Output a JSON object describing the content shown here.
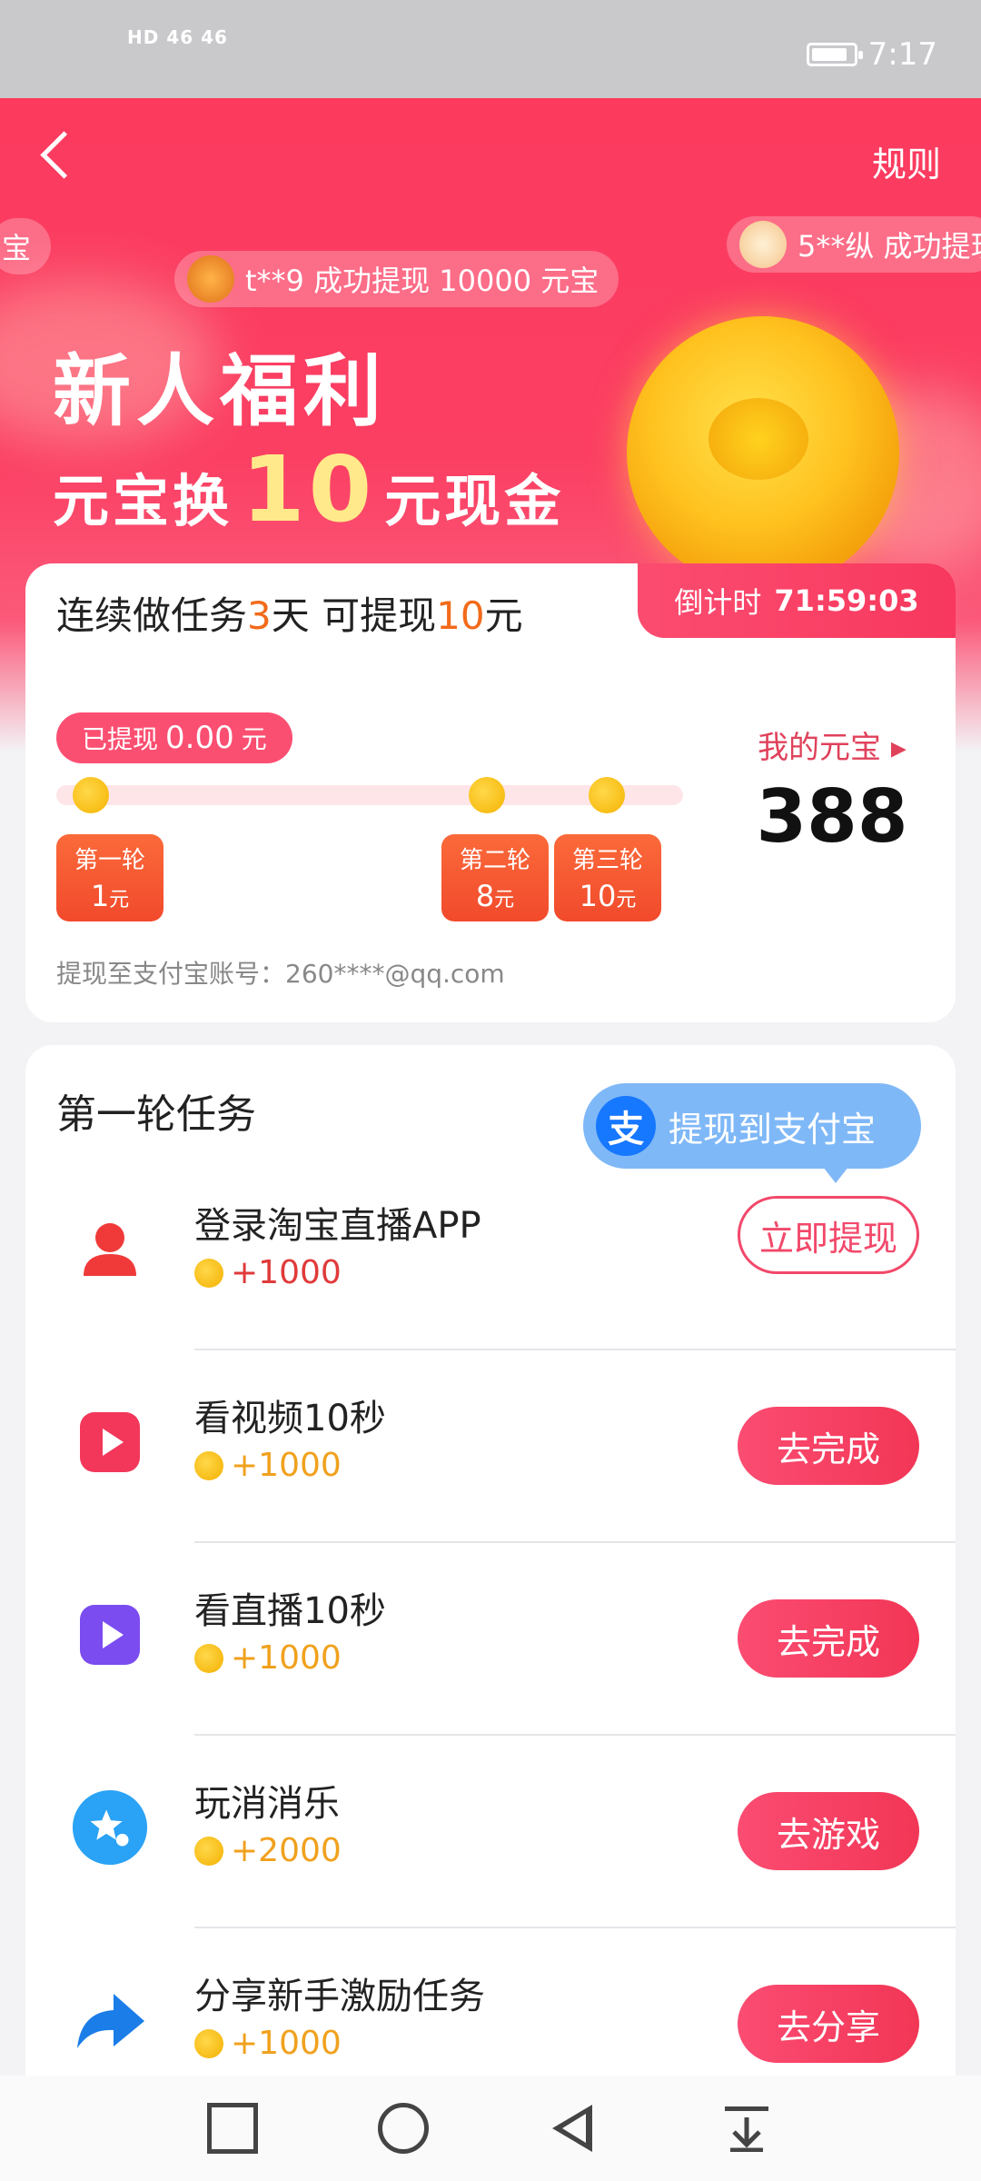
{
  "status_bar": {
    "left": "HD 46 46",
    "time": "7:17"
  },
  "header": {
    "back_label": "",
    "rules_label": "规则"
  },
  "tickers": [
    {
      "text": "宝"
    },
    {
      "text": "t**9 成功提现 10000 元宝"
    },
    {
      "text": "5**纵 成功提现"
    }
  ],
  "hero": {
    "line1": "新人福利",
    "line2_prefix": "元宝换",
    "line2_num": "10",
    "line2_suffix": "元现金"
  },
  "progress_card": {
    "title_a": "连续做任务",
    "title_days": "3",
    "title_b": "天 可提现",
    "title_amt": "10",
    "title_c": "元",
    "countdown_label": "倒计时",
    "countdown_value": "71:59:03",
    "withdrawn_label": "已提现",
    "withdrawn_value": "0.00",
    "withdrawn_unit": "元",
    "rounds": [
      {
        "label": "第一轮",
        "amount": "1",
        "unit": "元"
      },
      {
        "label": "第二轮",
        "amount": "8",
        "unit": "元"
      },
      {
        "label": "第三轮",
        "amount": "10",
        "unit": "元"
      }
    ],
    "my_coins_label": "我的元宝",
    "my_coins_value": "388",
    "alipay_account": "提现至支付宝账号：260****@qq.com"
  },
  "tasks_card": {
    "title": "第一轮任务",
    "tooltip_logo": "支",
    "tooltip_text": "提现到支付宝",
    "tasks": [
      {
        "name": "登录淘宝直播APP",
        "reward": "+1000",
        "button": "立即提现",
        "icon": "user-icon",
        "color": "#f03a3a"
      },
      {
        "name": "看视频10秒",
        "reward": "+1000",
        "button": "去完成",
        "icon": "video-play-icon",
        "color": "#f2375a"
      },
      {
        "name": "看直播10秒",
        "reward": "+1000",
        "button": "去完成",
        "icon": "live-play-icon",
        "color": "#7b4cf0"
      },
      {
        "name": "玩消消乐",
        "reward": "+2000",
        "button": "去游戏",
        "icon": "game-star-icon",
        "color": "#2aa2f5"
      },
      {
        "name": "分享新手激励任务",
        "reward": "+1000",
        "button": "去分享",
        "icon": "share-arrow-icon",
        "color": "#1a7de8"
      }
    ]
  },
  "colors": {
    "brand": "#fb3a5e",
    "coin": "#f5b300",
    "accent": "#f26a1a"
  }
}
